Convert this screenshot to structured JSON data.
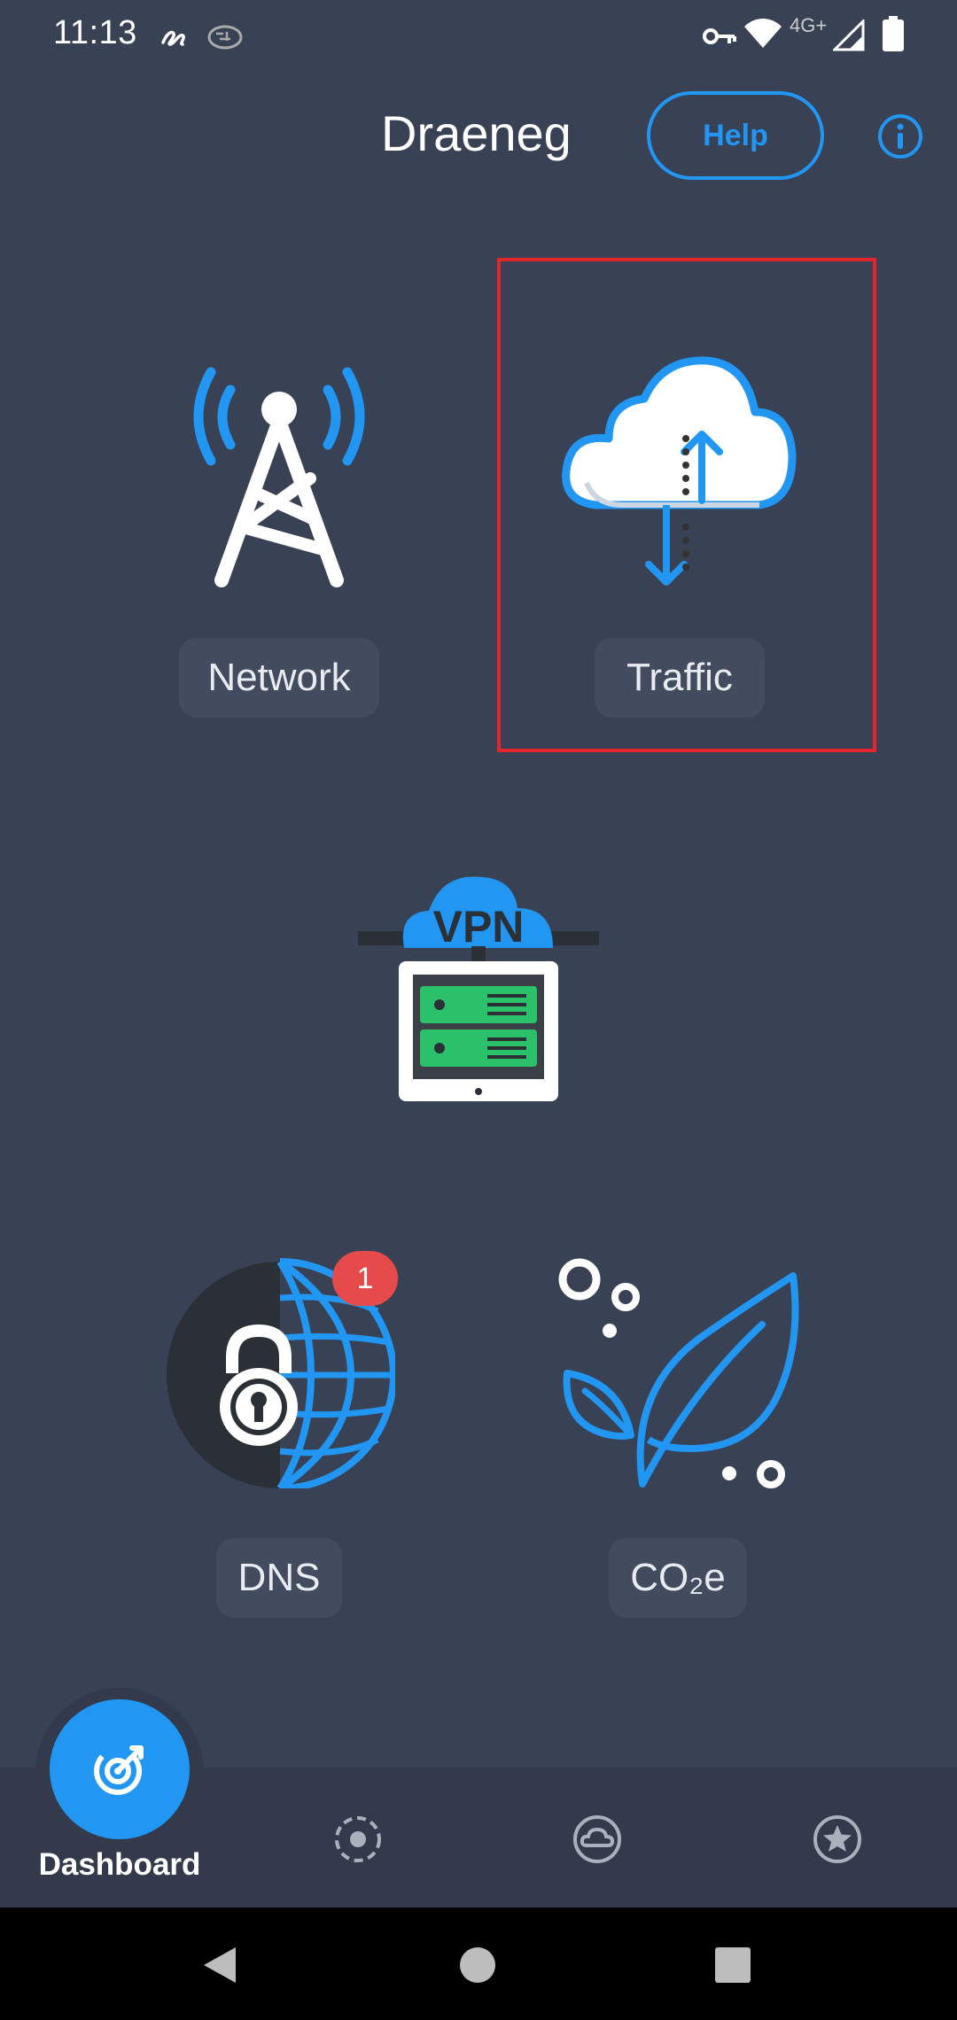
{
  "colors": {
    "background": "#394154",
    "accent": "#2196f3",
    "label_bg": "#434b5e",
    "badge": "#e64a4a",
    "highlight": "#e2262b",
    "vpn_green": "#2bc16a"
  },
  "status_bar": {
    "time": "11:13",
    "network": "4G+"
  },
  "header": {
    "title": "Draeneg",
    "help_label": "Help"
  },
  "tiles": {
    "network_label": "Network",
    "traffic_label": "Traffic",
    "vpn_text": "VPN",
    "dns_label": "DNS",
    "dns_badge": "1",
    "co2_label": "CO₂e"
  },
  "bottom_nav": {
    "dashboard_label": "Dashboard",
    "icons": [
      "dashboard-icon",
      "settings-dial-icon",
      "cloud-icon",
      "star-icon"
    ]
  },
  "system_nav": {
    "icons": [
      "back-icon",
      "home-icon",
      "recents-icon"
    ]
  }
}
